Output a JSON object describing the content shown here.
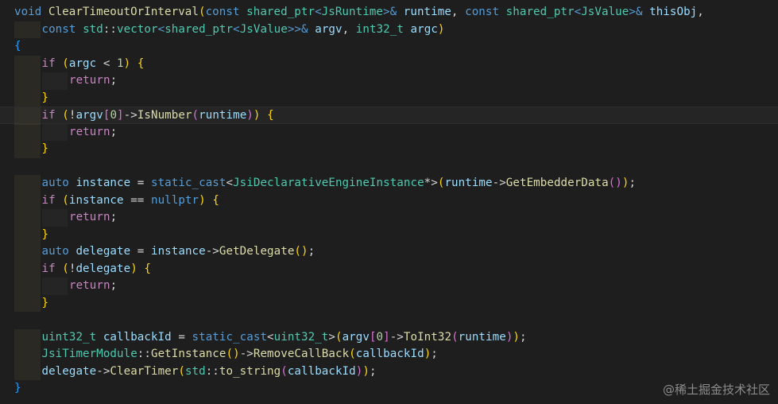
{
  "colors": {
    "background": "#1e1e1e",
    "keyword": "#569cd6",
    "control": "#c586c0",
    "type": "#4ec9b0",
    "function": "#dcdcaa",
    "variable": "#9cdcfe",
    "number": "#b5cea8",
    "plain": "#d4d4d4",
    "bracket1": "#ffd700",
    "bracket2": "#da70d6",
    "bracket3": "#179fff"
  },
  "watermark": "@稀土掘金技术社区",
  "code_lines": [
    {
      "indent": 0,
      "tokens": [
        [
          "void",
          "kw"
        ],
        [
          " ",
          "pl"
        ],
        [
          "ClearTimeoutOrInterval",
          "fn"
        ],
        [
          "(",
          "b1"
        ],
        [
          "const",
          "kw"
        ],
        [
          " ",
          "pl"
        ],
        [
          "shared_ptr",
          "ty"
        ],
        [
          "<",
          "kw"
        ],
        [
          "JsRuntime",
          "ty"
        ],
        [
          ">",
          "kw"
        ],
        [
          "&",
          "kw"
        ],
        [
          " ",
          "pl"
        ],
        [
          "runtime",
          "va"
        ],
        [
          ", ",
          "pl"
        ],
        [
          "const",
          "kw"
        ],
        [
          " ",
          "pl"
        ],
        [
          "shared_ptr",
          "ty"
        ],
        [
          "<",
          "kw"
        ],
        [
          "JsValue",
          "ty"
        ],
        [
          ">",
          "kw"
        ],
        [
          "&",
          "kw"
        ],
        [
          " ",
          "pl"
        ],
        [
          "thisObj",
          "va"
        ],
        [
          ",",
          "pl"
        ]
      ]
    },
    {
      "indent": 1,
      "tokens": [
        [
          "const",
          "kw"
        ],
        [
          " ",
          "pl"
        ],
        [
          "std",
          "ty"
        ],
        [
          "::",
          "pl"
        ],
        [
          "vector",
          "ty"
        ],
        [
          "<",
          "kw"
        ],
        [
          "shared_ptr",
          "ty"
        ],
        [
          "<",
          "kw"
        ],
        [
          "JsValue",
          "ty"
        ],
        [
          ">>",
          "kw"
        ],
        [
          "&",
          "kw"
        ],
        [
          " ",
          "pl"
        ],
        [
          "argv",
          "va"
        ],
        [
          ", ",
          "pl"
        ],
        [
          "int32_t",
          "ty"
        ],
        [
          " ",
          "pl"
        ],
        [
          "argc",
          "va"
        ],
        [
          ")",
          "b1"
        ]
      ]
    },
    {
      "indent": 0,
      "tokens": [
        [
          "{",
          "b3"
        ]
      ]
    },
    {
      "indent": 1,
      "tokens": [
        [
          "if",
          "ct"
        ],
        [
          " ",
          "pl"
        ],
        [
          "(",
          "b1"
        ],
        [
          "argc",
          "va"
        ],
        [
          " < ",
          "pl"
        ],
        [
          "1",
          "nu"
        ],
        [
          ")",
          "b1"
        ],
        [
          " ",
          "pl"
        ],
        [
          "{",
          "b1"
        ]
      ]
    },
    {
      "indent": 2,
      "tokens": [
        [
          "return",
          "ct"
        ],
        [
          ";",
          "pl"
        ]
      ]
    },
    {
      "indent": 1,
      "tokens": [
        [
          "}",
          "b1"
        ]
      ]
    },
    {
      "indent": 1,
      "current": true,
      "tokens": [
        [
          "if",
          "ct"
        ],
        [
          " ",
          "pl"
        ],
        [
          "(",
          "b1"
        ],
        [
          "!",
          "pl"
        ],
        [
          "argv",
          "va"
        ],
        [
          "[",
          "b2"
        ],
        [
          "0",
          "nu"
        ],
        [
          "]",
          "b2"
        ],
        [
          "->",
          "pl"
        ],
        [
          "IsNumber",
          "fn"
        ],
        [
          "(",
          "b2"
        ],
        [
          "runtime",
          "va"
        ],
        [
          ")",
          "b2"
        ],
        [
          ")",
          "b1"
        ],
        [
          " ",
          "pl"
        ],
        [
          "{",
          "b1"
        ]
      ]
    },
    {
      "indent": 2,
      "tokens": [
        [
          "return",
          "ct"
        ],
        [
          ";",
          "pl"
        ]
      ]
    },
    {
      "indent": 1,
      "tokens": [
        [
          "}",
          "b1"
        ]
      ]
    },
    {
      "indent": 0,
      "tokens": []
    },
    {
      "indent": 1,
      "tokens": [
        [
          "auto",
          "kw"
        ],
        [
          " ",
          "pl"
        ],
        [
          "instance",
          "va"
        ],
        [
          " = ",
          "pl"
        ],
        [
          "static_cast",
          "kw"
        ],
        [
          "<",
          "pl"
        ],
        [
          "JsiDeclarativeEngineInstance",
          "ty"
        ],
        [
          "*>",
          "pl"
        ],
        [
          "(",
          "b1"
        ],
        [
          "runtime",
          "va"
        ],
        [
          "->",
          "pl"
        ],
        [
          "GetEmbedderData",
          "fn"
        ],
        [
          "()",
          "b2"
        ],
        [
          ")",
          "b1"
        ],
        [
          ";",
          "pl"
        ]
      ]
    },
    {
      "indent": 1,
      "tokens": [
        [
          "if",
          "ct"
        ],
        [
          " ",
          "pl"
        ],
        [
          "(",
          "b1"
        ],
        [
          "instance",
          "va"
        ],
        [
          " == ",
          "pl"
        ],
        [
          "nullptr",
          "kw"
        ],
        [
          ")",
          "b1"
        ],
        [
          " ",
          "pl"
        ],
        [
          "{",
          "b1"
        ]
      ]
    },
    {
      "indent": 2,
      "tokens": [
        [
          "return",
          "ct"
        ],
        [
          ";",
          "pl"
        ]
      ]
    },
    {
      "indent": 1,
      "tokens": [
        [
          "}",
          "b1"
        ]
      ]
    },
    {
      "indent": 1,
      "tokens": [
        [
          "auto",
          "kw"
        ],
        [
          " ",
          "pl"
        ],
        [
          "delegate",
          "va"
        ],
        [
          " = ",
          "pl"
        ],
        [
          "instance",
          "va"
        ],
        [
          "->",
          "pl"
        ],
        [
          "GetDelegate",
          "fn"
        ],
        [
          "()",
          "b1"
        ],
        [
          ";",
          "pl"
        ]
      ]
    },
    {
      "indent": 1,
      "tokens": [
        [
          "if",
          "ct"
        ],
        [
          " ",
          "pl"
        ],
        [
          "(",
          "b1"
        ],
        [
          "!",
          "pl"
        ],
        [
          "delegate",
          "va"
        ],
        [
          ")",
          "b1"
        ],
        [
          " ",
          "pl"
        ],
        [
          "{",
          "b1"
        ]
      ]
    },
    {
      "indent": 2,
      "tokens": [
        [
          "return",
          "ct"
        ],
        [
          ";",
          "pl"
        ]
      ]
    },
    {
      "indent": 1,
      "tokens": [
        [
          "}",
          "b1"
        ]
      ]
    },
    {
      "indent": 0,
      "tokens": []
    },
    {
      "indent": 1,
      "tokens": [
        [
          "uint32_t",
          "ty"
        ],
        [
          " ",
          "pl"
        ],
        [
          "callbackId",
          "va"
        ],
        [
          " = ",
          "pl"
        ],
        [
          "static_cast",
          "kw"
        ],
        [
          "<",
          "pl"
        ],
        [
          "uint32_t",
          "ty"
        ],
        [
          ">",
          "pl"
        ],
        [
          "(",
          "b1"
        ],
        [
          "argv",
          "va"
        ],
        [
          "[",
          "b2"
        ],
        [
          "0",
          "nu"
        ],
        [
          "]",
          "b2"
        ],
        [
          "->",
          "pl"
        ],
        [
          "ToInt32",
          "fn"
        ],
        [
          "(",
          "b2"
        ],
        [
          "runtime",
          "va"
        ],
        [
          ")",
          "b2"
        ],
        [
          ")",
          "b1"
        ],
        [
          ";",
          "pl"
        ]
      ]
    },
    {
      "indent": 1,
      "tokens": [
        [
          "JsiTimerModule",
          "ty"
        ],
        [
          "::",
          "pl"
        ],
        [
          "GetInstance",
          "fn"
        ],
        [
          "()",
          "b1"
        ],
        [
          "->",
          "pl"
        ],
        [
          "RemoveCallBack",
          "fn"
        ],
        [
          "(",
          "b1"
        ],
        [
          "callbackId",
          "va"
        ],
        [
          ")",
          "b1"
        ],
        [
          ";",
          "pl"
        ]
      ]
    },
    {
      "indent": 1,
      "tokens": [
        [
          "delegate",
          "va"
        ],
        [
          "->",
          "pl"
        ],
        [
          "ClearTimer",
          "fn"
        ],
        [
          "(",
          "b1"
        ],
        [
          "std",
          "ty"
        ],
        [
          "::",
          "pl"
        ],
        [
          "to_string",
          "fn"
        ],
        [
          "(",
          "b2"
        ],
        [
          "callbackId",
          "va"
        ],
        [
          ")",
          "b2"
        ],
        [
          ")",
          "b1"
        ],
        [
          ";",
          "pl"
        ]
      ]
    },
    {
      "indent": 0,
      "tokens": [
        [
          "}",
          "b3"
        ]
      ]
    }
  ]
}
